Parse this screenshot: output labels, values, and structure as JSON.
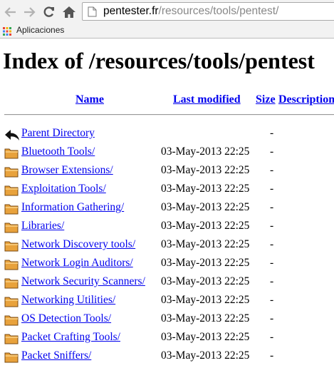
{
  "browser": {
    "url_host": "pentester.fr",
    "url_path": "/resources/tools/pentest/",
    "bookmarks_label": "Aplicaciones"
  },
  "page": {
    "title": "Index of /resources/tools/pentest",
    "columns": {
      "name": "Name",
      "last_modified": "Last modified",
      "size": "Size",
      "description": "Description"
    },
    "parent": {
      "name": "Parent Directory",
      "size": "-"
    },
    "entries": [
      {
        "name": "Bluetooth Tools/",
        "modified": "03-May-2013 22:25",
        "size": "-"
      },
      {
        "name": "Browser Extensions/",
        "modified": "03-May-2013 22:25",
        "size": "-"
      },
      {
        "name": "Exploitation Tools/",
        "modified": "03-May-2013 22:25",
        "size": "-"
      },
      {
        "name": "Information Gathering/",
        "modified": "03-May-2013 22:25",
        "size": "-"
      },
      {
        "name": "Libraries/",
        "modified": "03-May-2013 22:25",
        "size": "-"
      },
      {
        "name": "Network Discovery tools/",
        "modified": "03-May-2013 22:25",
        "size": "-"
      },
      {
        "name": "Network Login Auditors/",
        "modified": "03-May-2013 22:25",
        "size": "-"
      },
      {
        "name": "Network Security Scanners/",
        "modified": "03-May-2013 22:25",
        "size": "-"
      },
      {
        "name": "Networking Utilities/",
        "modified": "03-May-2013 22:25",
        "size": "-"
      },
      {
        "name": "OS Detection Tools/",
        "modified": "03-May-2013 22:25",
        "size": "-"
      },
      {
        "name": "Packet Crafting Tools/",
        "modified": "03-May-2013 22:25",
        "size": "-"
      },
      {
        "name": "Packet Sniffers/",
        "modified": "03-May-2013 22:25",
        "size": "-"
      }
    ]
  }
}
